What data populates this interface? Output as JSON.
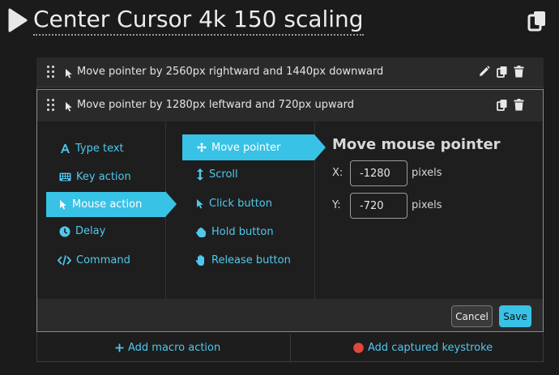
{
  "header": {
    "title": "Center Cursor 4k 150 scaling"
  },
  "macro": {
    "actions": [
      {
        "text": "Move pointer by 2560px rightward and 1440px downward"
      },
      {
        "text": "Move pointer by 1280px leftward and 720px upward"
      }
    ]
  },
  "editor": {
    "categories": [
      {
        "label": "Type text",
        "icon": "type-text-icon"
      },
      {
        "label": "Key action",
        "icon": "keyboard-icon"
      },
      {
        "label": "Mouse action",
        "icon": "cursor-icon",
        "selected": true
      },
      {
        "label": "Delay",
        "icon": "clock-icon"
      },
      {
        "label": "Command",
        "icon": "code-icon"
      }
    ],
    "subactions": [
      {
        "label": "Move pointer",
        "icon": "move-icon",
        "selected": true
      },
      {
        "label": "Scroll",
        "icon": "scroll-icon"
      },
      {
        "label": "Click button",
        "icon": "cursor-icon"
      },
      {
        "label": "Hold button",
        "icon": "hand-grab-icon"
      },
      {
        "label": "Release button",
        "icon": "hand-open-icon"
      }
    ],
    "panel": {
      "title": "Move mouse pointer",
      "x_label": "X:",
      "x_value": "-1280",
      "y_label": "Y:",
      "y_value": "-720",
      "unit": "pixels"
    },
    "cancel_label": "Cancel",
    "save_label": "Save"
  },
  "footer": {
    "add_action_label": "Add macro action",
    "add_keystroke_label": "Add captured keystroke"
  },
  "colors": {
    "accent": "#38c2e6",
    "link": "#4fc8ee",
    "record": "#e0473f",
    "background": "#1b1b1b"
  }
}
